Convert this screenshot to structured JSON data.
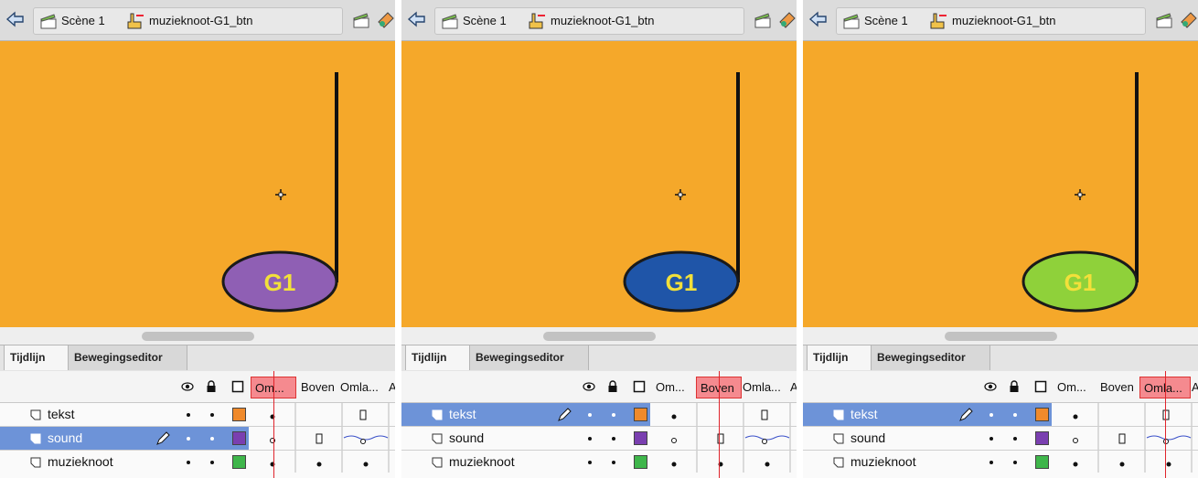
{
  "panels": [
    {
      "breadcrumb": {
        "scene": "Scène 1",
        "symbol": "muzieknoot-G1_btn"
      },
      "note": {
        "label": "G1",
        "fill": "#8f5fb4"
      },
      "tabs": {
        "timeline": "Tijdlijn",
        "motion_editor": "Bewegingseditor"
      },
      "frame_labels": [
        "Om...",
        "Boven",
        "Omla...",
        "A"
      ],
      "current_frame": "Up",
      "layers": [
        {
          "name": "tekst",
          "color": "#f08a2b",
          "selected": false
        },
        {
          "name": "sound",
          "color": "#7a3fb0",
          "selected": true
        },
        {
          "name": "muzieknoot",
          "color": "#3fb64b",
          "selected": false
        }
      ]
    },
    {
      "breadcrumb": {
        "scene": "Scène 1",
        "symbol": "muzieknoot-G1_btn"
      },
      "note": {
        "label": "G1",
        "fill": "#1f55a8"
      },
      "tabs": {
        "timeline": "Tijdlijn",
        "motion_editor": "Bewegingseditor"
      },
      "frame_labels": [
        "Om...",
        "Boven",
        "Omla...",
        "A"
      ],
      "current_frame": "Over",
      "layers": [
        {
          "name": "tekst",
          "color": "#f08a2b",
          "selected": true
        },
        {
          "name": "sound",
          "color": "#7a3fb0",
          "selected": false
        },
        {
          "name": "muzieknoot",
          "color": "#3fb64b",
          "selected": false
        }
      ]
    },
    {
      "breadcrumb": {
        "scene": "Scène 1",
        "symbol": "muzieknoot-G1_btn"
      },
      "note": {
        "label": "G1",
        "fill": "#8fd13a"
      },
      "tabs": {
        "timeline": "Tijdlijn",
        "motion_editor": "Bewegingseditor"
      },
      "frame_labels": [
        "Om...",
        "Boven",
        "Omla...",
        "A"
      ],
      "current_frame": "Down",
      "layers": [
        {
          "name": "tekst",
          "color": "#f08a2b",
          "selected": true
        },
        {
          "name": "sound",
          "color": "#7a3fb0",
          "selected": false
        },
        {
          "name": "muzieknoot",
          "color": "#3fb64b",
          "selected": false
        }
      ]
    }
  ],
  "icons": {
    "back": "back-arrow-icon",
    "scene": "scene-clapper-icon",
    "symbol": "button-symbol-icon",
    "edit_scene": "edit-scene-icon",
    "edit_symbol": "edit-symbol-icon",
    "eye": "eye-icon",
    "lock": "lock-icon",
    "outline": "outline-icon",
    "layer": "layer-icon",
    "pencil": "pencil-icon",
    "registration": "registration-point-icon"
  },
  "colors": {
    "stage": "#f5a82a",
    "selection": "#6d93d8",
    "playhead": "#e0242c",
    "current_label": "#f58a8f"
  }
}
